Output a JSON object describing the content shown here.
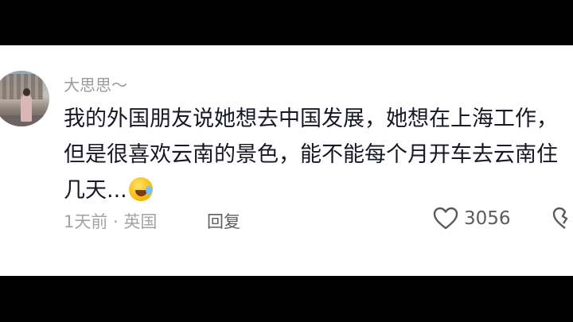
{
  "comment": {
    "username": "大思思～",
    "text": "我的外国朋友说她想去中国发展，她想在上海工作，但是很喜欢云南的景色，能不能每个月开车去云南住几天...",
    "meta": "1天前 · 英国",
    "reply_label": "回复",
    "like_count": "3056",
    "emoji": "crying-laughing-emoji"
  },
  "icons": {
    "like": "heart-outline-icon",
    "dislike": "broken-heart-icon"
  },
  "colors": {
    "text": "#161823",
    "secondary": "#a3a3a3",
    "background": "#ffffff"
  }
}
